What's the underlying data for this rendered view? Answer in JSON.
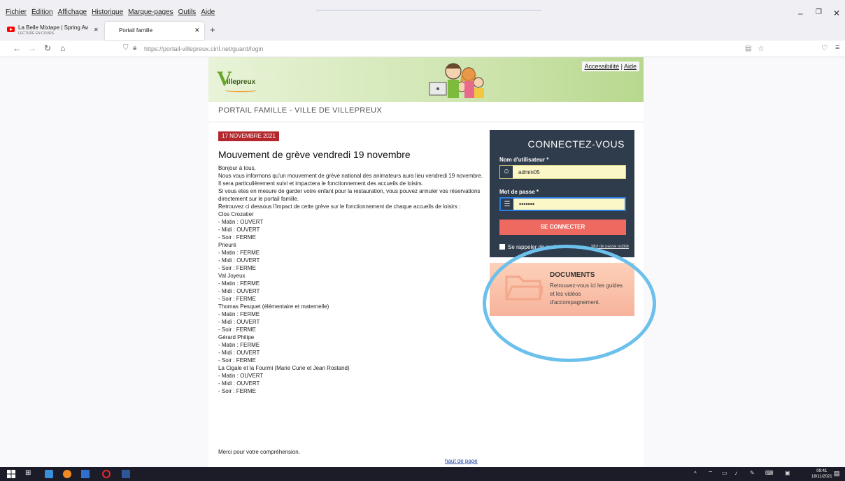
{
  "menubar": {
    "items": [
      "Fichier",
      "Édition",
      "Affichage",
      "Historique",
      "Marque-pages",
      "Outils",
      "Aide"
    ]
  },
  "tabs": [
    {
      "title": "La Belle Mixtape | Spring Awake",
      "subtitle": "LECTURE EN COURS"
    },
    {
      "title": "Portail famille"
    }
  ],
  "url": "https://portail-villepreux.ciril.net/guard/login",
  "site": {
    "logo_letter": "V",
    "logo_text": "illepreux",
    "toplinks": {
      "accessibility": "Accessibilité",
      "separator": "|",
      "help": "Aide"
    },
    "portal_title": "PORTAIL FAMILLE - VILLE DE VILLEPREUX"
  },
  "article": {
    "date": "17 NOVEMBRE 2021",
    "headline": "Mouvement de grève vendredi 19 novembre",
    "lines": [
      "Bonjour à tous,",
      "Nous vous informons qu'un mouvement de grève national des animateurs aura lieu vendredi 19 novembre. Il sera particulièrement suivi et impactera le fonctionnement des accueils de loisirs.",
      "Si vous etes en mesure de garder votre enfant pour la restauration, vous pouvez annuler vos réservations directement sur le portail famille.",
      "Retrouvez ci dessous l'impact de cette grève sur le fonctionnement de chaque accueils de loisirs :",
      "Clos Crozatier",
      "- Matin : OUVERT",
      "- Midi : OUVERT",
      "- Soir : FERME",
      "Prieuré",
      "- Matin : FERME",
      "- Midi : OUVERT",
      "- Soir : FERME",
      "Val Joyeux",
      "- Matin : FERME",
      "- Midi : OUVERT",
      "- Soir : FERME",
      "Thomas Pesquet (élémentaire et maternelle)",
      "- Matin : FERME",
      "- Midi : OUVERT",
      "- Soir : FERME",
      "Gérard Philipe",
      "- Matin : FERME",
      "- Midi : OUVERT",
      "- Soir : FERME",
      "La Cigale et la Fourmi (Marie Curie et Jean Rostand)",
      "- Matin : OUVERT",
      "- Midi : OUVERT",
      "- Soir : FERME"
    ],
    "closing": "Merci pour votre compréhension.",
    "back_to_top": "haut de page"
  },
  "login": {
    "title": "CONNECTEZ-VOUS",
    "username_label": "Nom d'utilisateur *",
    "username_value": "admin05",
    "password_label": "Mot de passe *",
    "password_value": "•••••••",
    "submit": "SE CONNECTER",
    "remember": "Se rappeler de moi",
    "forgot": "Mot de passe oublié"
  },
  "documents": {
    "title": "DOCUMENTS",
    "text": "Retrouvez-vous ici les guides et les vidéos d'accompagnement."
  },
  "taskbar": {
    "time": "09:41",
    "date": "18/11/2021"
  },
  "colors": {
    "date_badge": "#b3272d",
    "login_bg": "#2f3c4b",
    "login_button": "#ee6a60",
    "highlight": "#6cc0ec",
    "banner_green": "#b8d88e"
  }
}
